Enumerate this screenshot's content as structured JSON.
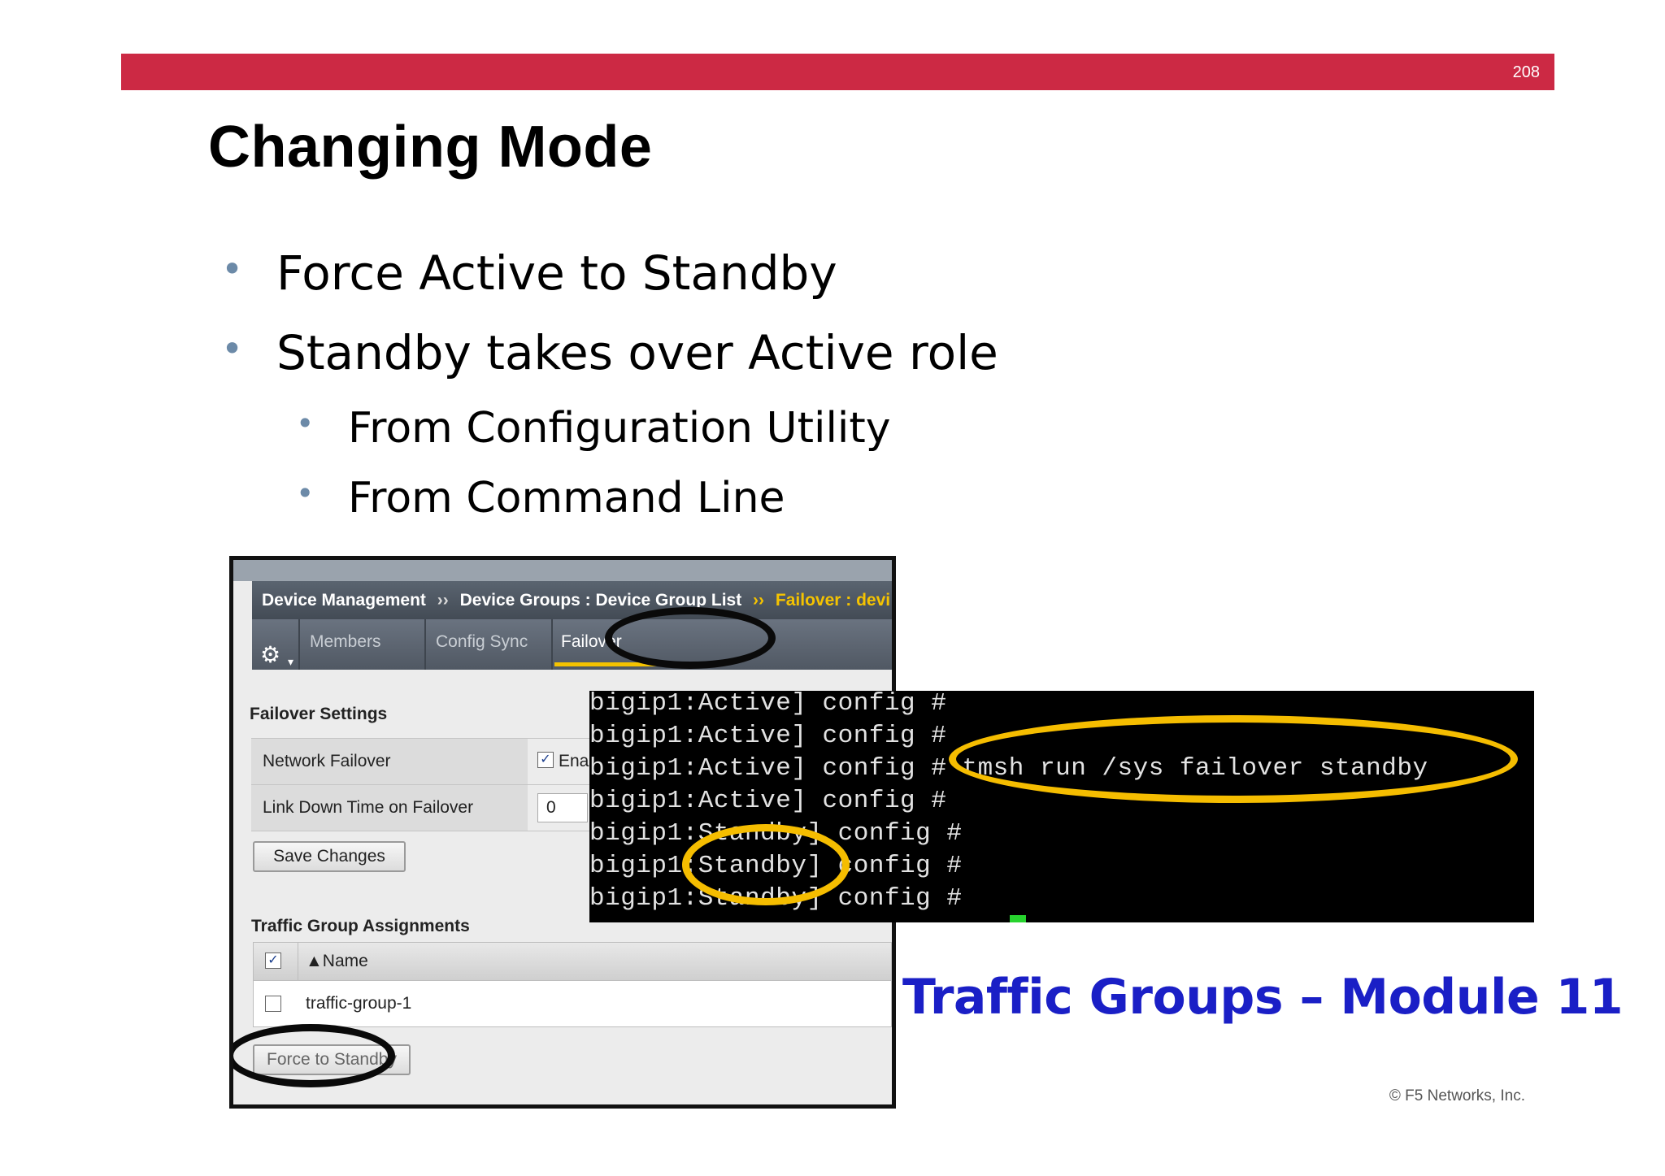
{
  "slide": {
    "page_number": "208",
    "title": "Changing Mode",
    "bullets": [
      "Force Active to Standby",
      "Standby takes over Active role"
    ],
    "sub_bullets": [
      "From Configuration Utility",
      "From Command Line"
    ],
    "module_note": "Traffic Groups – Module 11",
    "copyright": "© F5 Networks, Inc."
  },
  "ui": {
    "breadcrumb": {
      "part1": "Device Management",
      "sep": "››",
      "part2": "Device Groups : Device Group List",
      "part3": "Failover : devi"
    },
    "tabs": {
      "gear_glyph": "⚙",
      "caret_glyph": "▾",
      "members": "Members",
      "config_sync": "Config Sync",
      "failover": "Failover"
    },
    "failover_settings": {
      "title": "Failover Settings",
      "network_failover_label": "Network Failover",
      "network_failover_check": "✓",
      "network_failover_value": "Ena",
      "link_down_label": "Link Down Time on Failover",
      "link_down_value": "0"
    },
    "save_button": "Save Changes",
    "traffic_groups": {
      "title": "Traffic Group Assignments",
      "header_check": "✓",
      "column_name": "▲Name",
      "row_name": "traffic-group-1"
    },
    "force_button": "Force to Standby"
  },
  "terminal": {
    "lines": [
      "bigip1:Active] config #",
      "bigip1:Active] config #",
      "bigip1:Active] config # tmsh run /sys failover standby",
      "bigip1:Active] config #",
      "bigip1:Standby] config #",
      "bigip1:Standby] config #",
      "bigip1:Standby] config #"
    ]
  },
  "colors": {
    "accent_red": "#cc2944",
    "highlight_gold": "#f5bd00",
    "module_blue": "#1a1fc6",
    "cursor_green": "#27d32e"
  }
}
